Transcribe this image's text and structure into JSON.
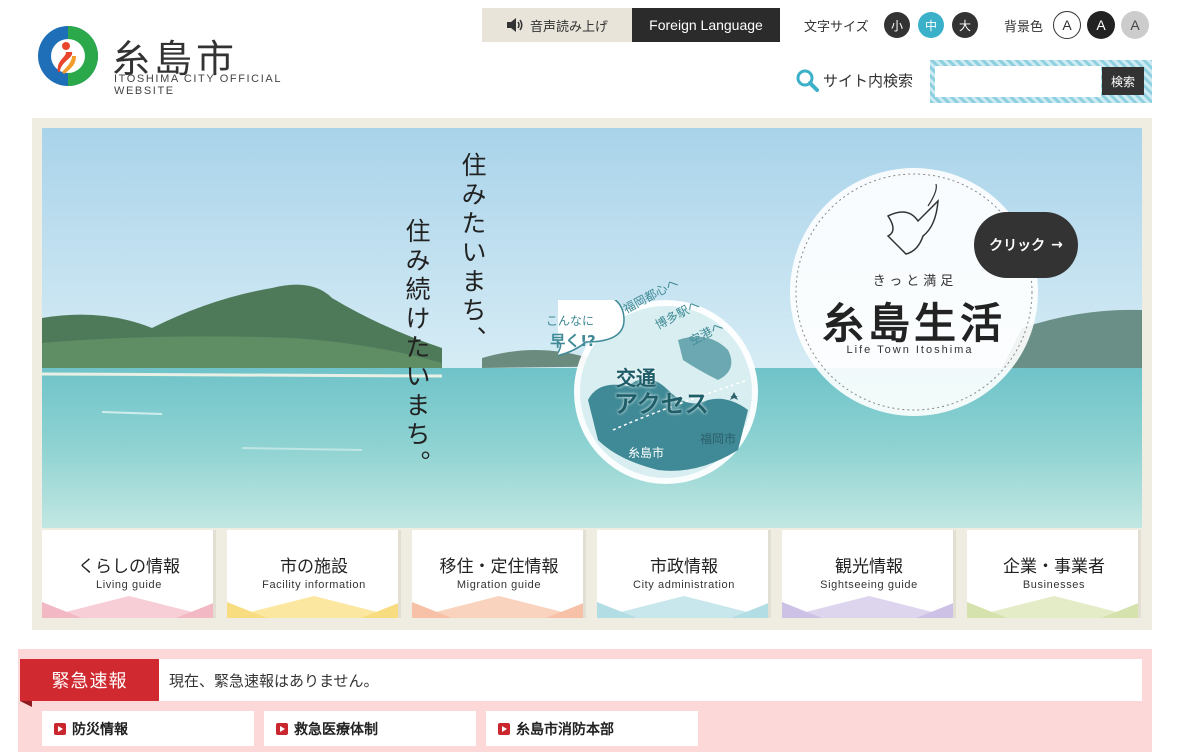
{
  "header": {
    "logo_title": "糸島市",
    "logo_subtitle": "ITOSHIMA CITY OFFICIAL WEBSITE",
    "voice_button": "音声読み上げ",
    "foreign_button": "Foreign Language",
    "font_size_label": "文字サイズ",
    "font_sizes": [
      "小",
      "中",
      "大"
    ],
    "bg_color_label": "背景色",
    "bg_colors": [
      "A",
      "A",
      "A"
    ],
    "search_label": "サイト内検索",
    "search_placeholder": "",
    "search_button": "検索"
  },
  "hero": {
    "tagline_1": "住みたいまち、",
    "tagline_2": "住み続けたいまち。",
    "access_bubble_line1": "こんなに",
    "access_bubble_line2": "早く!?",
    "access_dest_1": "福岡都心へ",
    "access_dest_2": "博多駅へ",
    "access_dest_3": "空港へ",
    "access_title_1": "交通",
    "access_title_2": "アクセス",
    "map_label_itoshima": "糸島市",
    "map_label_fukuoka": "福岡市",
    "life_tag": "きっと満足",
    "life_title": "糸島生活",
    "life_en": "Life Town Itoshima",
    "click_label": "クリック"
  },
  "categories": [
    {
      "ja": "くらしの情報",
      "en": "Living guide",
      "color": "#f7cdd6"
    },
    {
      "ja": "市の施設",
      "en": "Facility information",
      "color": "#fbe7a0"
    },
    {
      "ja": "移住・定住情報",
      "en": "Migration guide",
      "color": "#fad3be"
    },
    {
      "ja": "市政情報",
      "en": "City administration",
      "color": "#c8e7ec"
    },
    {
      "ja": "観光情報",
      "en": "Sightseeing guide",
      "color": "#ddd5ee"
    },
    {
      "ja": "企業・事業者",
      "en": "Businesses",
      "color": "#e3ecc6"
    }
  ],
  "emergency": {
    "label": "緊急速報",
    "message": "現在、緊急速報はありません。",
    "links": [
      "防災情報",
      "救急医療体制",
      "糸島市消防本部"
    ]
  },
  "colors": {
    "accent_teal": "#3bb0c9",
    "emergency_red": "#d0292f",
    "emergency_bg": "#fdd8d8",
    "frame_beige": "#efece2"
  }
}
